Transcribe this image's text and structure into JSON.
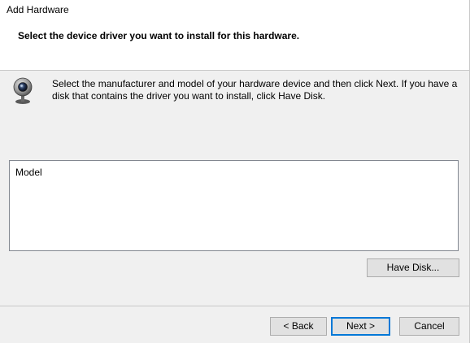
{
  "window": {
    "title": "Add Hardware"
  },
  "header": {
    "heading": "Select the device driver you want to install for this hardware."
  },
  "instructions": {
    "text": "Select the manufacturer and model of your hardware device and then click Next. If you have a disk that contains the driver you want to install, click Have Disk.",
    "icon": "webcam-icon"
  },
  "model_list": {
    "header": "Model",
    "items": []
  },
  "buttons": {
    "have_disk": "Have Disk...",
    "back": "< Back",
    "next": "Next >",
    "cancel": "Cancel"
  },
  "colors": {
    "accent": "#0078d7",
    "window_bg": "#f0f0f0",
    "header_bg": "#ffffff",
    "button_bg": "#e1e1e1"
  }
}
